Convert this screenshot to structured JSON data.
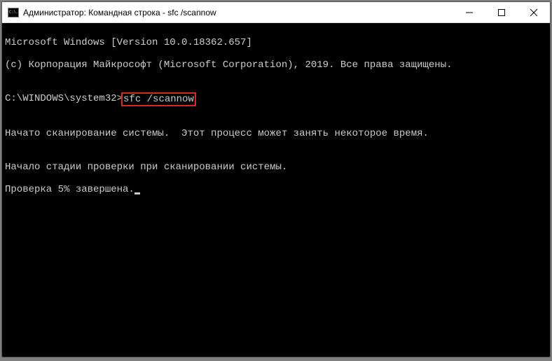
{
  "titlebar": {
    "icon_label": "cmd-icon",
    "icon_text": "C:\\.",
    "title": "Администратор: Командная строка - sfc  /scannow"
  },
  "console": {
    "line1": "Microsoft Windows [Version 10.0.18362.657]",
    "line2": "(c) Корпорация Майкрософт (Microsoft Corporation), 2019. Все права защищены.",
    "blank": "",
    "prompt": "C:\\WINDOWS\\system32>",
    "command": "sfc /scannow",
    "line_scan_start": "Начато сканирование системы.  Этот процесс может занять некоторое время.",
    "line_stage": "Начало стадии проверки при сканировании системы.",
    "line_progress": "Проверка 5% завершена."
  }
}
